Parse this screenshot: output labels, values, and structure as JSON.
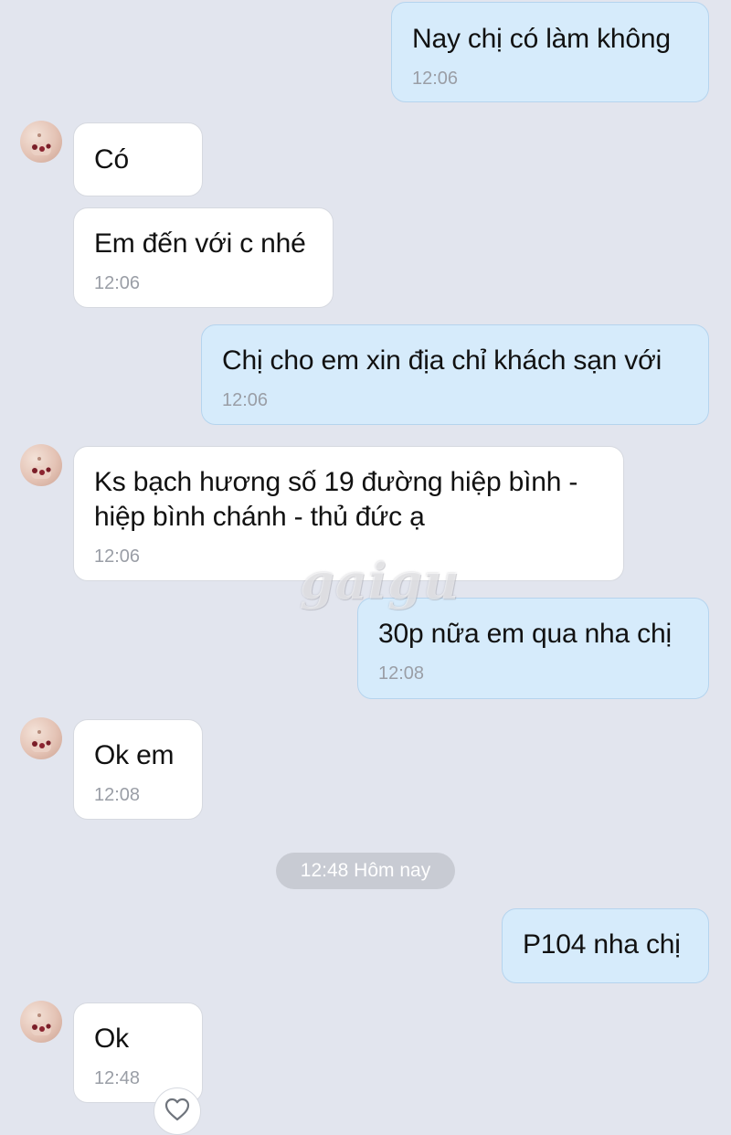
{
  "messages": [
    {
      "text": "Nay chị có làm không",
      "time": "12:06"
    },
    {
      "text": "Có",
      "time": ""
    },
    {
      "text": "Em đến với c nhé",
      "time": "12:06"
    },
    {
      "text": "Chị cho em xin địa chỉ khách sạn với",
      "time": "12:06"
    },
    {
      "text": "Ks bạch hương số 19 đường hiệp bình -\nhiệp bình chánh - thủ đức ạ",
      "time": "12:06"
    },
    {
      "text": "30p nữa em qua nha chị",
      "time": "12:08"
    },
    {
      "text": "Ok em",
      "time": "12:08"
    },
    {
      "text": "P104 nha chị",
      "time": ""
    },
    {
      "text": "Ok",
      "time": "12:48"
    }
  ],
  "date_divider": "12:48 Hôm nay",
  "watermark": "gaigu",
  "icons": {
    "avatar": "contact-avatar",
    "reaction": "heart-outline-icon"
  },
  "colors": {
    "background": "#e2e5ee",
    "incoming_bubble": "#ffffff",
    "outgoing_bubble": "#d6ebfb",
    "timestamp": "#9a9ea6"
  }
}
